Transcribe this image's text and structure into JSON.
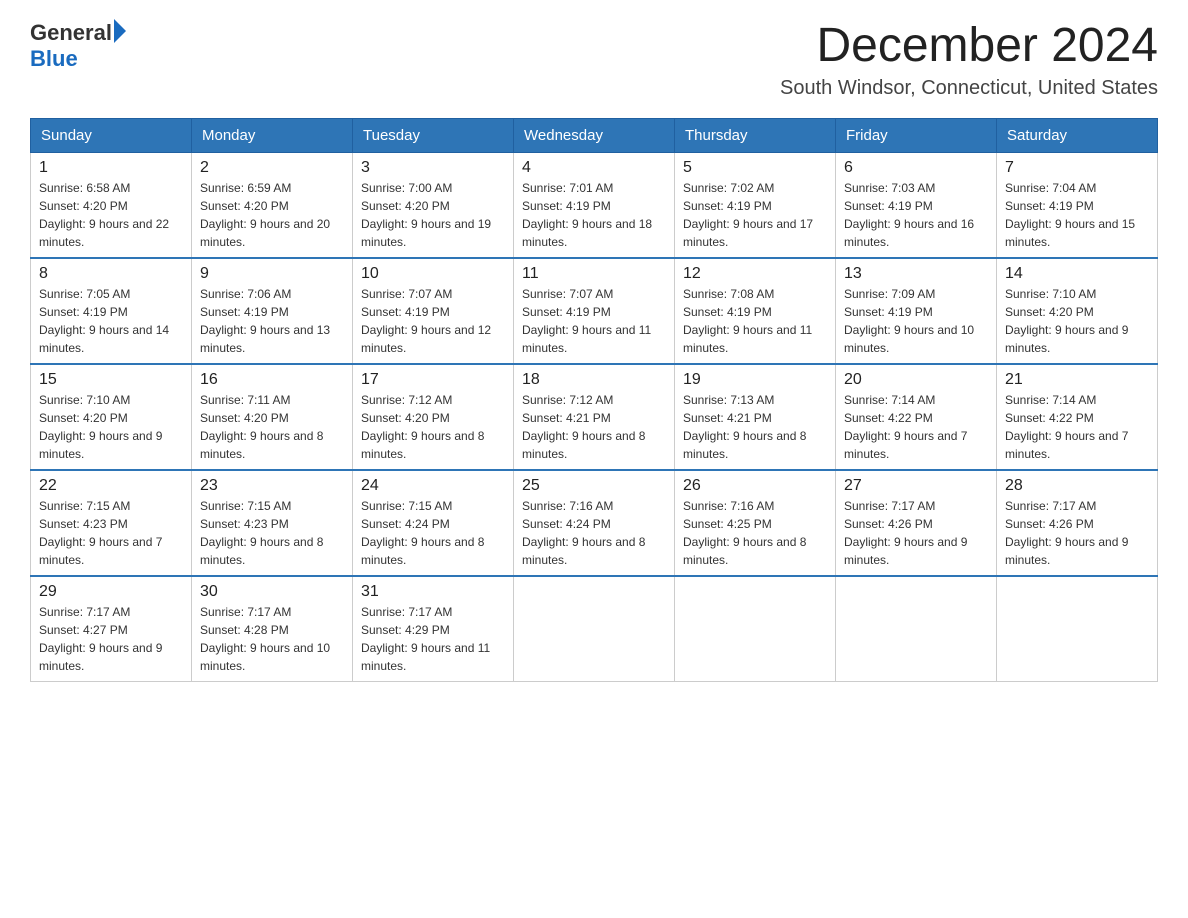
{
  "header": {
    "logo_general": "General",
    "logo_blue": "Blue",
    "month_title": "December 2024",
    "location": "South Windsor, Connecticut, United States"
  },
  "weekdays": [
    "Sunday",
    "Monday",
    "Tuesday",
    "Wednesday",
    "Thursday",
    "Friday",
    "Saturday"
  ],
  "weeks": [
    [
      {
        "day": "1",
        "sunrise": "6:58 AM",
        "sunset": "4:20 PM",
        "daylight": "9 hours and 22 minutes."
      },
      {
        "day": "2",
        "sunrise": "6:59 AM",
        "sunset": "4:20 PM",
        "daylight": "9 hours and 20 minutes."
      },
      {
        "day": "3",
        "sunrise": "7:00 AM",
        "sunset": "4:20 PM",
        "daylight": "9 hours and 19 minutes."
      },
      {
        "day": "4",
        "sunrise": "7:01 AM",
        "sunset": "4:19 PM",
        "daylight": "9 hours and 18 minutes."
      },
      {
        "day": "5",
        "sunrise": "7:02 AM",
        "sunset": "4:19 PM",
        "daylight": "9 hours and 17 minutes."
      },
      {
        "day": "6",
        "sunrise": "7:03 AM",
        "sunset": "4:19 PM",
        "daylight": "9 hours and 16 minutes."
      },
      {
        "day": "7",
        "sunrise": "7:04 AM",
        "sunset": "4:19 PM",
        "daylight": "9 hours and 15 minutes."
      }
    ],
    [
      {
        "day": "8",
        "sunrise": "7:05 AM",
        "sunset": "4:19 PM",
        "daylight": "9 hours and 14 minutes."
      },
      {
        "day": "9",
        "sunrise": "7:06 AM",
        "sunset": "4:19 PM",
        "daylight": "9 hours and 13 minutes."
      },
      {
        "day": "10",
        "sunrise": "7:07 AM",
        "sunset": "4:19 PM",
        "daylight": "9 hours and 12 minutes."
      },
      {
        "day": "11",
        "sunrise": "7:07 AM",
        "sunset": "4:19 PM",
        "daylight": "9 hours and 11 minutes."
      },
      {
        "day": "12",
        "sunrise": "7:08 AM",
        "sunset": "4:19 PM",
        "daylight": "9 hours and 11 minutes."
      },
      {
        "day": "13",
        "sunrise": "7:09 AM",
        "sunset": "4:19 PM",
        "daylight": "9 hours and 10 minutes."
      },
      {
        "day": "14",
        "sunrise": "7:10 AM",
        "sunset": "4:20 PM",
        "daylight": "9 hours and 9 minutes."
      }
    ],
    [
      {
        "day": "15",
        "sunrise": "7:10 AM",
        "sunset": "4:20 PM",
        "daylight": "9 hours and 9 minutes."
      },
      {
        "day": "16",
        "sunrise": "7:11 AM",
        "sunset": "4:20 PM",
        "daylight": "9 hours and 8 minutes."
      },
      {
        "day": "17",
        "sunrise": "7:12 AM",
        "sunset": "4:20 PM",
        "daylight": "9 hours and 8 minutes."
      },
      {
        "day": "18",
        "sunrise": "7:12 AM",
        "sunset": "4:21 PM",
        "daylight": "9 hours and 8 minutes."
      },
      {
        "day": "19",
        "sunrise": "7:13 AM",
        "sunset": "4:21 PM",
        "daylight": "9 hours and 8 minutes."
      },
      {
        "day": "20",
        "sunrise": "7:14 AM",
        "sunset": "4:22 PM",
        "daylight": "9 hours and 7 minutes."
      },
      {
        "day": "21",
        "sunrise": "7:14 AM",
        "sunset": "4:22 PM",
        "daylight": "9 hours and 7 minutes."
      }
    ],
    [
      {
        "day": "22",
        "sunrise": "7:15 AM",
        "sunset": "4:23 PM",
        "daylight": "9 hours and 7 minutes."
      },
      {
        "day": "23",
        "sunrise": "7:15 AM",
        "sunset": "4:23 PM",
        "daylight": "9 hours and 8 minutes."
      },
      {
        "day": "24",
        "sunrise": "7:15 AM",
        "sunset": "4:24 PM",
        "daylight": "9 hours and 8 minutes."
      },
      {
        "day": "25",
        "sunrise": "7:16 AM",
        "sunset": "4:24 PM",
        "daylight": "9 hours and 8 minutes."
      },
      {
        "day": "26",
        "sunrise": "7:16 AM",
        "sunset": "4:25 PM",
        "daylight": "9 hours and 8 minutes."
      },
      {
        "day": "27",
        "sunrise": "7:17 AM",
        "sunset": "4:26 PM",
        "daylight": "9 hours and 9 minutes."
      },
      {
        "day": "28",
        "sunrise": "7:17 AM",
        "sunset": "4:26 PM",
        "daylight": "9 hours and 9 minutes."
      }
    ],
    [
      {
        "day": "29",
        "sunrise": "7:17 AM",
        "sunset": "4:27 PM",
        "daylight": "9 hours and 9 minutes."
      },
      {
        "day": "30",
        "sunrise": "7:17 AM",
        "sunset": "4:28 PM",
        "daylight": "9 hours and 10 minutes."
      },
      {
        "day": "31",
        "sunrise": "7:17 AM",
        "sunset": "4:29 PM",
        "daylight": "9 hours and 11 minutes."
      },
      null,
      null,
      null,
      null
    ]
  ]
}
